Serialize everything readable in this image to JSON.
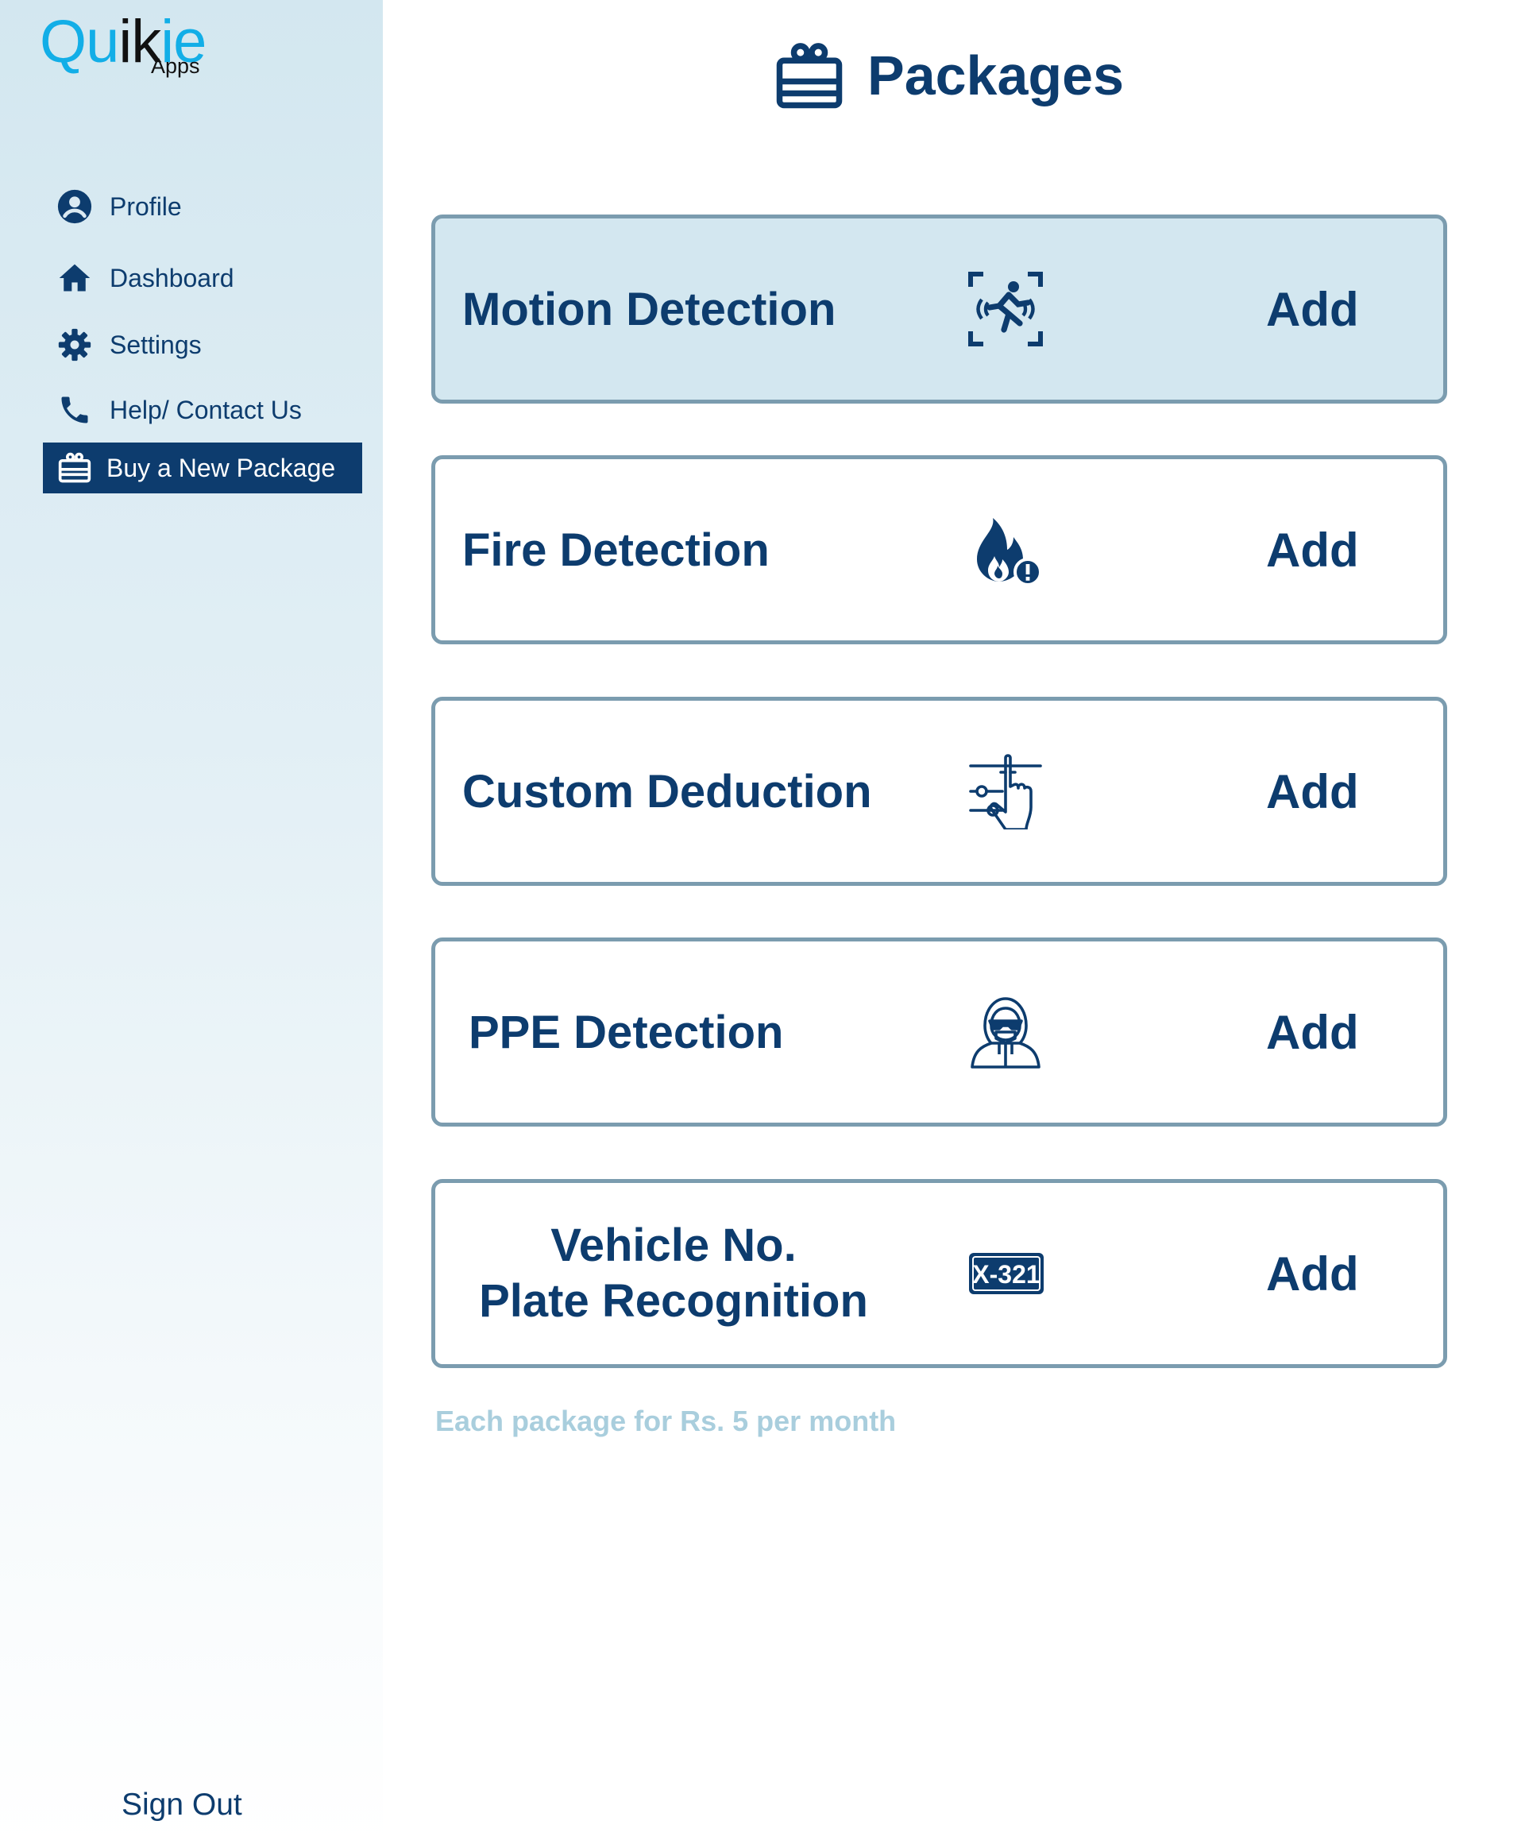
{
  "logo": {
    "q": "Qu",
    "i": "i",
    "k": "k",
    "ie": "ie",
    "apps": "Apps"
  },
  "sidebar": {
    "items": [
      {
        "label": "Profile",
        "icon": "account-circle-icon"
      },
      {
        "label": "Dashboard",
        "icon": "home-icon"
      },
      {
        "label": "Settings",
        "icon": "gear-icon"
      },
      {
        "label": "Help/ Contact Us",
        "icon": "phone-icon"
      },
      {
        "label": "Buy a New Package",
        "icon": "gift-box-icon",
        "active": true
      }
    ],
    "sign_out": "Sign Out"
  },
  "header": {
    "title": "Packages",
    "icon": "gift-box-icon"
  },
  "packages": [
    {
      "name": "Motion Detection",
      "icon": "running-person-scan-icon",
      "action": "Add",
      "highlighted": true
    },
    {
      "name": "Fire Detection",
      "icon": "fire-alert-icon",
      "action": "Add"
    },
    {
      "name": "Custom Deduction",
      "icon": "touch-sliders-icon",
      "action": "Add"
    },
    {
      "name": "PPE Detection",
      "icon": "ppe-suit-person-icon",
      "action": "Add"
    },
    {
      "name_line1": "Vehicle No.",
      "name_line2": "Plate Recognition",
      "icon": "license-plate-icon",
      "plate_text": "X-321",
      "action": "Add"
    }
  ],
  "footnote": "Each package for Rs. 5 per month",
  "colors": {
    "primary": "#0d3c6e",
    "accent": "#12aee7",
    "card_border": "#7b9caf",
    "highlight_bg": "#d3e7f0",
    "footnote": "#a9cedd"
  }
}
